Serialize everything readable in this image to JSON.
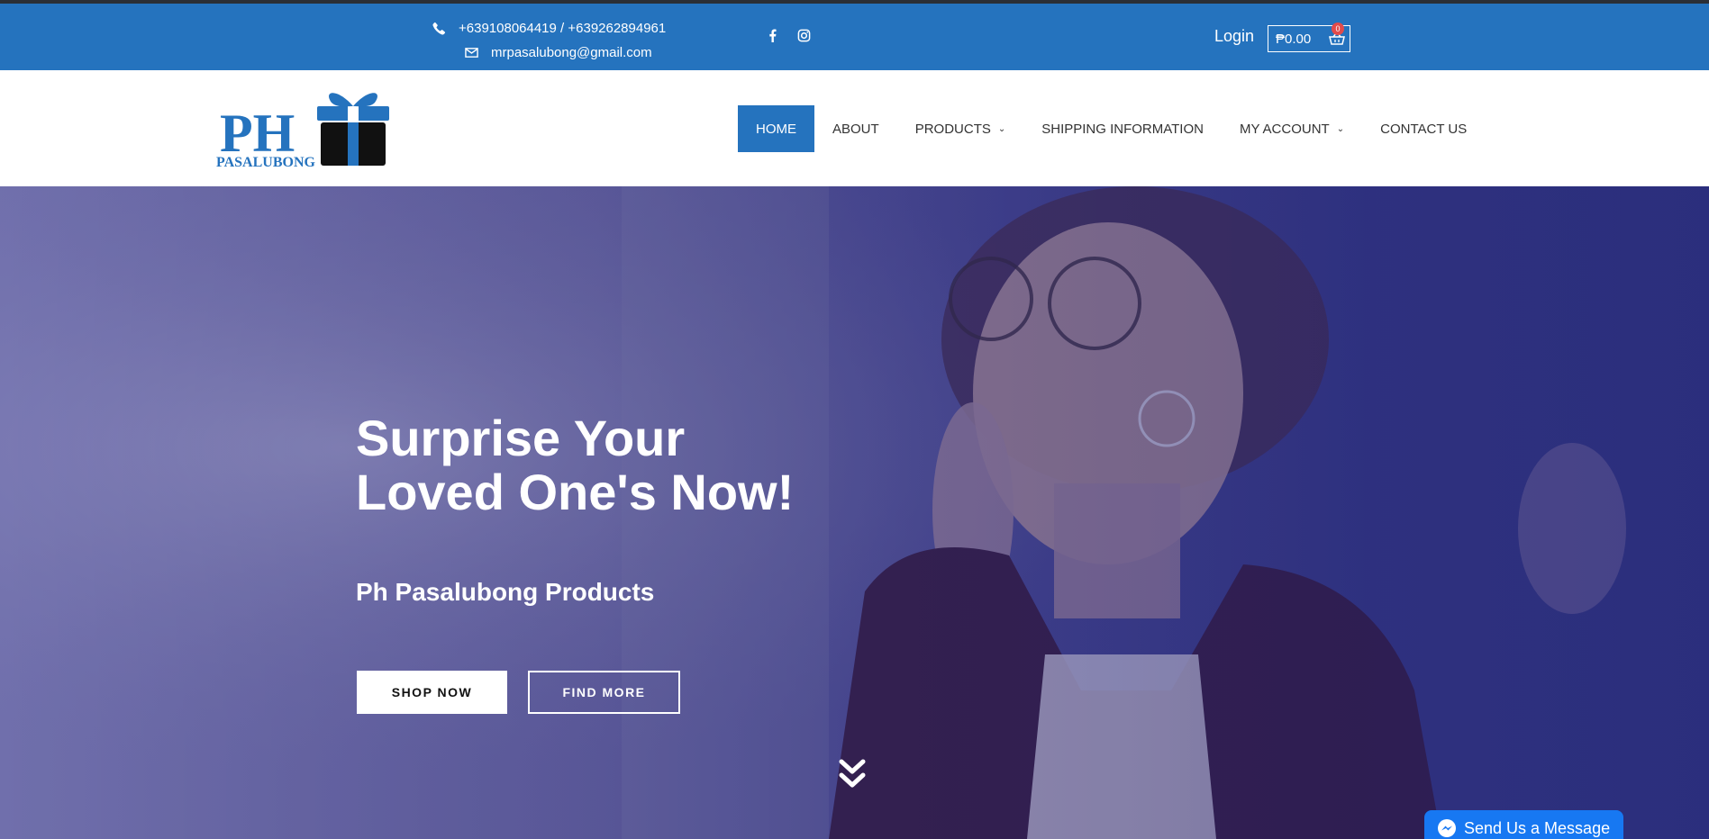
{
  "topbar": {
    "phone": "+639108064419 / +639262894961",
    "email": "mrpasalubong@gmail.com",
    "login_label": "Login",
    "cart_total": "₱0.00",
    "cart_count": "0"
  },
  "brand": {
    "logo_main": "PH",
    "logo_sub": "PASALUBONG",
    "primary_color": "#2573be"
  },
  "nav": {
    "items": [
      {
        "label": "HOME",
        "active": true
      },
      {
        "label": "ABOUT"
      },
      {
        "label": "PRODUCTS",
        "dropdown": true
      },
      {
        "label": "SHIPPING INFORMATION"
      },
      {
        "label": "MY ACCOUNT",
        "dropdown": true
      },
      {
        "label": "CONTACT US"
      }
    ]
  },
  "hero": {
    "title_line1": "Surprise Your",
    "title_line2": "Loved One's Now!",
    "subtitle": "Ph Pasalubong Products",
    "shop_label": "SHOP NOW",
    "find_label": "FIND MORE"
  },
  "messenger": {
    "label": "Send Us a Message"
  },
  "icons": [
    "phone-icon",
    "envelope-icon",
    "facebook-icon",
    "instagram-icon",
    "basket-icon",
    "chevron-down-icon",
    "double-chevron-down-icon",
    "messenger-icon"
  ]
}
